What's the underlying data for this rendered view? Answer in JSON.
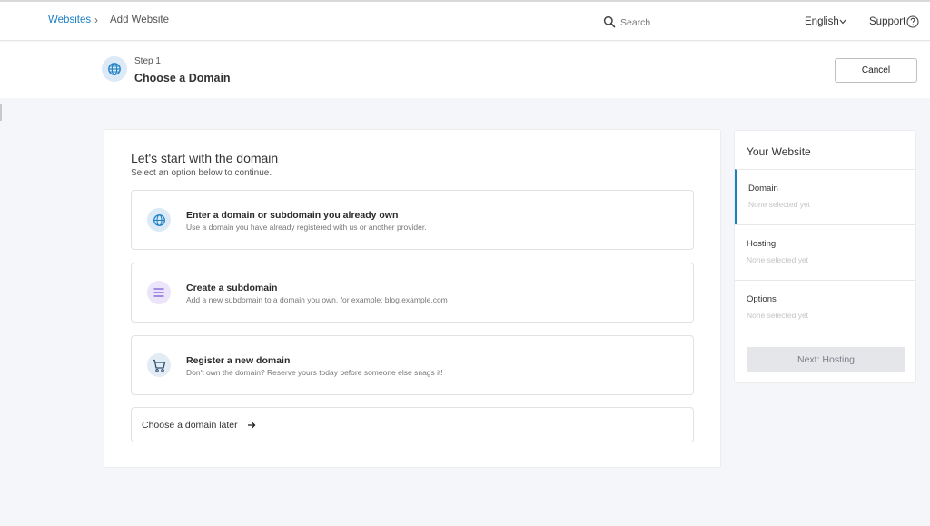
{
  "breadcrumb": {
    "root": "Websites",
    "separator": "›",
    "current": "Add Website"
  },
  "search": {
    "placeholder": "Search",
    "value": ""
  },
  "language": "English",
  "support": "Support",
  "step": {
    "number": "Step 1",
    "title": "Choose a Domain"
  },
  "cancel_label": "Cancel",
  "main": {
    "title": "Let's start with the domain",
    "subtitle": "Select an option below to continue.",
    "options": [
      {
        "title": "Enter a domain or subdomain you already own",
        "description": "Use a domain you have already registered with us or another provider.",
        "icon": "globe-icon"
      },
      {
        "title": "Create a subdomain",
        "description": "Add a new subdomain to a domain you own, for example: blog.example.com",
        "icon": "list-icon"
      },
      {
        "title": "Register a new domain",
        "description": "Don't own the domain? Reserve yours today before someone else snags it!",
        "icon": "cart-icon"
      }
    ],
    "later_label": "Choose a domain later"
  },
  "sidebar": {
    "title": "Your Website",
    "rows": [
      {
        "label": "Domain",
        "value": "None selected yet"
      },
      {
        "label": "Hosting",
        "value": "None selected yet"
      },
      {
        "label": "Options",
        "value": "None selected yet"
      }
    ],
    "next_label": "Next: Hosting"
  },
  "colors": {
    "accent": "#1b7fc4",
    "background": "#f4f6f9",
    "disabled_button": "#e4e6ea"
  }
}
